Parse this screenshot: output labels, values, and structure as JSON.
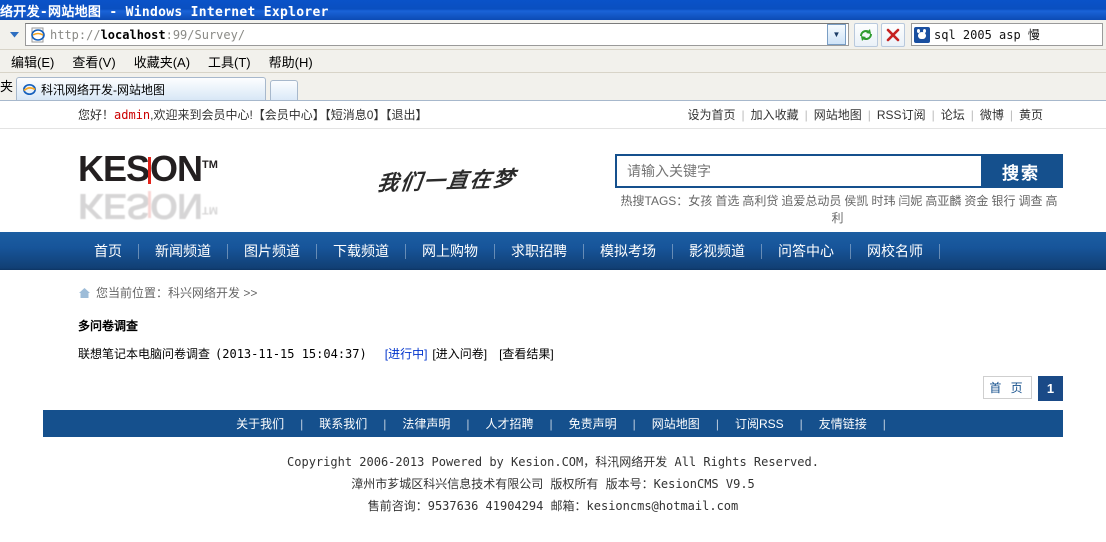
{
  "browser": {
    "window_title": "络开发-网站地图 - Windows Internet Explorer",
    "url": "http://localhost:99/Survey/",
    "url_scheme": "http://",
    "url_host": "localhost",
    "url_path": ":99/Survey/",
    "menu_items": [
      "编辑(E)",
      "查看(V)",
      "收藏夹(A)",
      "工具(T)",
      "帮助(H)"
    ],
    "favorites_stub": "夹",
    "tab_title": "科汛网络开发-网站地图",
    "chrome_search_value": "sql 2005 asp 慢",
    "icons": {
      "back_dropdown": "chevron-down-icon",
      "refresh": "refresh-icon",
      "stop": "stop-icon",
      "baidu": "baidu-paw-icon"
    }
  },
  "topbar": {
    "greeting_prefix": "您好！",
    "username": "admin",
    "greeting_suffix": ",欢迎来到会员中心!【会员中心】【短消息0】【退出】",
    "links": [
      "设为首页",
      "加入收藏",
      "网站地图",
      "RSS订阅",
      "论坛",
      "微博",
      "黄页"
    ]
  },
  "header": {
    "logo_part1": "KES",
    "logo_part2": "I",
    "logo_part3": "ON",
    "logo_tm": "TM",
    "slogan": "我们一直在梦",
    "search": {
      "placeholder": "请输入关键字",
      "value": "",
      "button_label": "搜索"
    },
    "hot_tags_label": "热搜TAGS：",
    "hot_tags": [
      "女孩",
      "首选",
      "高利贷",
      "追爱总动员",
      "侯凯",
      "时玮",
      "闫妮",
      "高亚麟",
      "资金",
      "银行",
      "调查",
      "高利"
    ]
  },
  "mainnav": [
    "首页",
    "新闻频道",
    "图片频道",
    "下载频道",
    "网上购物",
    "求职招聘",
    "模拟考场",
    "影视频道",
    "问答中心",
    "网校名师"
  ],
  "breadcrumb": {
    "text": "您当前位置：科兴网络开发  >>",
    "icon": "home-icon"
  },
  "content": {
    "section_title": "多问卷调查",
    "survey": {
      "name": "联想笔记本电脑问卷调查",
      "date": "(2013-11-15 15:04:37)",
      "status": "[进行中]",
      "action_enter": "[进入问卷]",
      "action_results": "[查看结果]"
    }
  },
  "pager": {
    "first_label": "首 页",
    "current_page": "1"
  },
  "footer": {
    "links": [
      "关于我们",
      "联系我们",
      "法律声明",
      "人才招聘",
      "免责声明",
      "网站地图",
      "订阅RSS",
      "友情链接"
    ],
    "copyright_line1": "Copyright 2006-2013 Powered by Kesion.COM，科汛网络开发 All Rights Reserved.",
    "copyright_line2": "漳州市芗城区科兴信息技术有限公司 版权所有 版本号：KesionCMS V9.5",
    "copyright_line3": "售前咨询：9537636 41904294 邮箱：kesioncms@hotmail.com"
  },
  "colors": {
    "brand_blue": "#15508d",
    "nav_blue_top": "#1c5ea2",
    "nav_blue_bottom": "#0d3463",
    "accent_red": "#cc0000",
    "link_blue": "#0033cc"
  }
}
